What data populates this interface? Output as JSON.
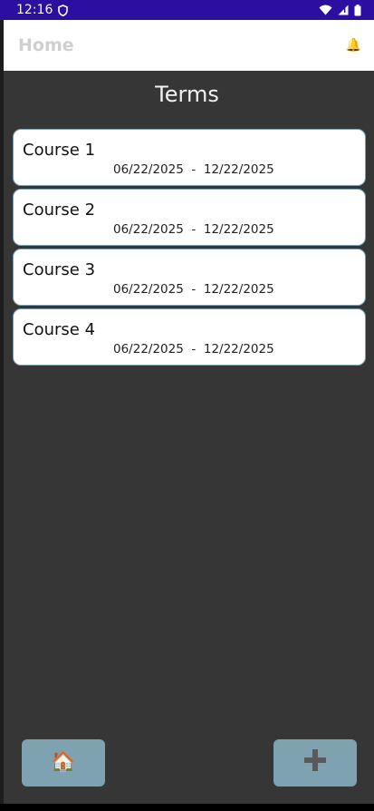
{
  "status_bar": {
    "time": "12:16"
  },
  "app_bar": {
    "title": "Home",
    "bell_icon": "bell-icon"
  },
  "page": {
    "title": "Terms"
  },
  "courses": [
    {
      "name": "Course 1",
      "start": "06/22/2025",
      "end": "12/22/2025"
    },
    {
      "name": "Course 2",
      "start": "06/22/2025",
      "end": "12/22/2025"
    },
    {
      "name": "Course 3",
      "start": "06/22/2025",
      "end": "12/22/2025"
    },
    {
      "name": "Course 4",
      "start": "06/22/2025",
      "end": "12/22/2025"
    }
  ],
  "bottom": {
    "home_icon": "house-icon",
    "add_icon": "plus-icon"
  },
  "colors": {
    "status_bar": "#2c0ea0",
    "background": "#363636",
    "card_border": "#7aa0ae",
    "button": "#7fa2b1"
  }
}
